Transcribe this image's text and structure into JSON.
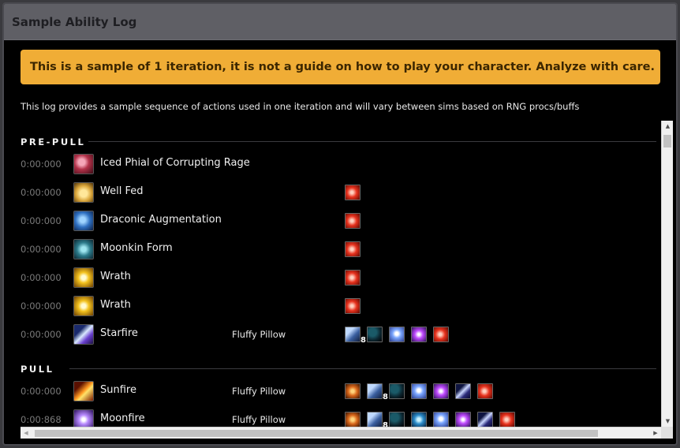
{
  "modal": {
    "title": "Sample Ability Log"
  },
  "alert": {
    "text": "This is a sample of 1 iteration, it is not a guide on how to play your character. Analyze with care."
  },
  "description": "This log provides a sample sequence of actions used in one iteration and will vary between sims based on RNG procs/buffs",
  "sections": {
    "prepull": {
      "label": "PRE-PULL"
    },
    "pull": {
      "label": "PULL"
    }
  },
  "rows": [
    {
      "time": "0:00:000",
      "ability": "Iced Phial of Corrupting Rage",
      "icon": "iced-phial-icon",
      "target": "",
      "buffs": []
    },
    {
      "time": "0:00:000",
      "ability": "Well Fed",
      "icon": "well-fed-icon",
      "target": "",
      "buffs": [
        "red-buff-icon"
      ]
    },
    {
      "time": "0:00:000",
      "ability": "Draconic Augmentation",
      "icon": "draconic-augmentation-icon",
      "target": "",
      "buffs": [
        "red-buff-icon"
      ]
    },
    {
      "time": "0:00:000",
      "ability": "Moonkin Form",
      "icon": "moonkin-form-icon",
      "target": "",
      "buffs": [
        "red-buff-icon"
      ]
    },
    {
      "time": "0:00:000",
      "ability": "Wrath",
      "icon": "wrath-icon",
      "target": "",
      "buffs": [
        "red-buff-icon"
      ]
    },
    {
      "time": "0:00:000",
      "ability": "Wrath",
      "icon": "wrath-icon",
      "target": "",
      "buffs": [
        "red-buff-icon"
      ]
    },
    {
      "time": "0:00:000",
      "ability": "Starfire",
      "icon": "starfire-icon",
      "target": "Fluffy Pillow",
      "buffs": [
        "stacking-buff-icon",
        "moon-buff-icon",
        "orb-buff-icon",
        "star-buff-icon",
        "red-buff-icon"
      ],
      "stack": "8"
    },
    {
      "time": "0:00:000",
      "ability": "Sunfire",
      "icon": "sunfire-icon",
      "target": "Fluffy Pillow",
      "buffs": [
        "roar-buff-icon",
        "stacking-buff-icon",
        "moon-buff-icon",
        "orb-buff-icon",
        "star-buff-icon",
        "bolt-buff-icon",
        "red-buff-icon"
      ],
      "stack": "8"
    },
    {
      "time": "0:00:868",
      "ability": "Moonfire",
      "icon": "moonfire-icon",
      "target": "Fluffy Pillow",
      "buffs": [
        "roar-buff-icon",
        "stacking-buff-icon",
        "moon-buff-icon",
        "sorb-buff-icon",
        "orb-buff-icon",
        "star-buff-icon",
        "bolt-buff-icon",
        "red-buff-icon"
      ],
      "stack": "8"
    }
  ]
}
